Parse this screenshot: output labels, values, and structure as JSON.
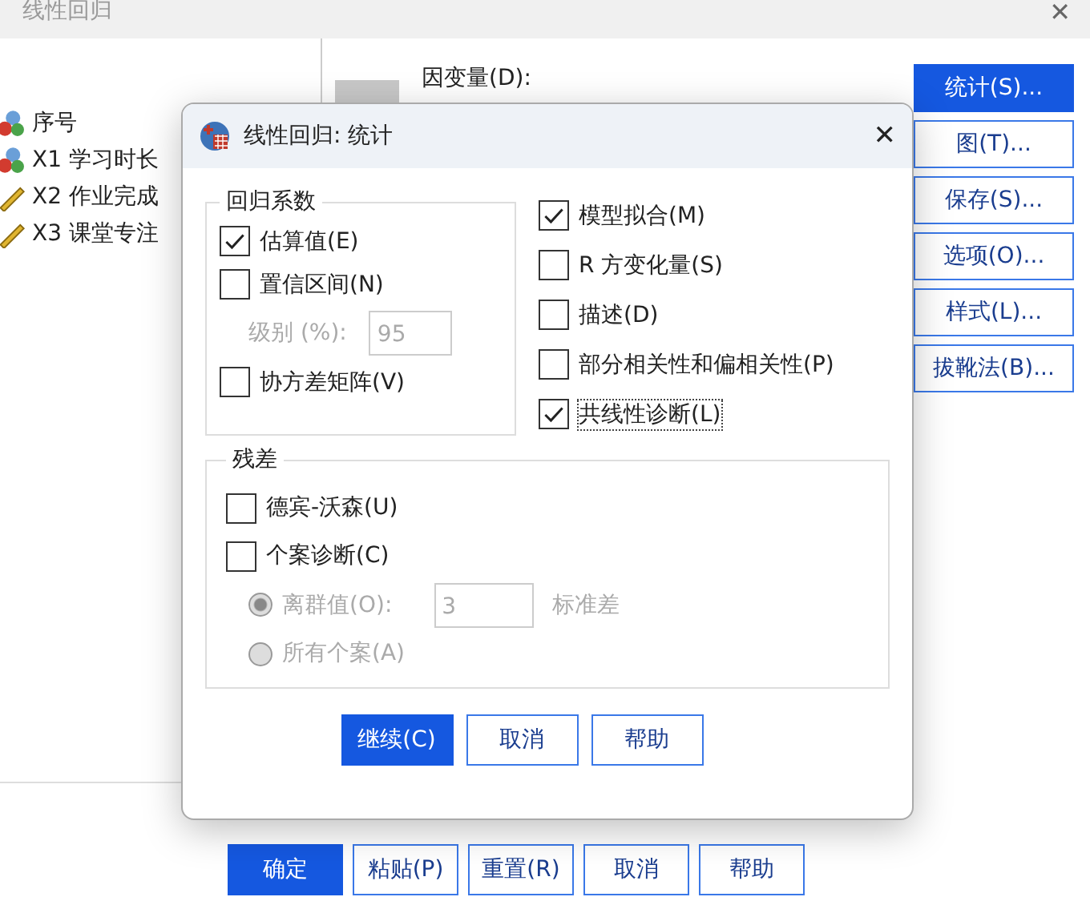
{
  "window": {
    "title": "线性回归",
    "close": "✕"
  },
  "variables": [
    {
      "kind": "scale",
      "label": "序号"
    },
    {
      "kind": "scale",
      "label": "X1 学习时长"
    },
    {
      "kind": "ordinal",
      "label": "X2 作业完成"
    },
    {
      "kind": "ordinal",
      "label": "X3 课堂专注"
    }
  ],
  "dependent_label": "因变量(D):",
  "side_buttons": [
    {
      "label": "统计(S)...",
      "selected": true
    },
    {
      "label": "图(T)...",
      "selected": false
    },
    {
      "label": "保存(S)...",
      "selected": false
    },
    {
      "label": "选项(O)...",
      "selected": false
    },
    {
      "label": "样式(L)...",
      "selected": false
    },
    {
      "label": "拔靴法(B)...",
      "selected": false
    }
  ],
  "bottom_buttons": [
    {
      "label": "确定",
      "selected": true
    },
    {
      "label": "粘贴(P)",
      "selected": false
    },
    {
      "label": "重置(R)",
      "selected": false
    },
    {
      "label": "取消",
      "selected": false
    },
    {
      "label": "帮助",
      "selected": false
    }
  ],
  "dialog": {
    "title": "线性回归: 统计",
    "close": "✕",
    "coefficients": {
      "title": "回归系数",
      "items": [
        {
          "kind": "checkbox",
          "label": "估算值(E)",
          "checked": true
        },
        {
          "kind": "checkbox",
          "label": "置信区间(N)",
          "checked": false
        },
        {
          "kind": "field",
          "label": "级别 (%):",
          "value": "95",
          "disabled": true
        },
        {
          "kind": "checkbox",
          "label": "协方差矩阵(V)",
          "checked": false
        }
      ]
    },
    "options": [
      {
        "label": "模型拟合(M)",
        "checked": true,
        "focused": false
      },
      {
        "label": "R 方变化量(S)",
        "checked": false,
        "focused": false
      },
      {
        "label": "描述(D)",
        "checked": false,
        "focused": false
      },
      {
        "label": "部分相关性和偏相关性(P)",
        "checked": false,
        "focused": false
      },
      {
        "label": "共线性诊断(L)",
        "checked": true,
        "focused": true
      }
    ],
    "residuals": {
      "title": "残差",
      "items": [
        {
          "kind": "checkbox",
          "label": "德宾-沃森(U)",
          "checked": false
        },
        {
          "kind": "checkbox",
          "label": "个案诊断(C)",
          "checked": false
        },
        {
          "kind": "radio",
          "label": "离群值(O):",
          "selected": true,
          "disabled": true,
          "value": "3",
          "unit": "标准差"
        },
        {
          "kind": "radio",
          "label": "所有个案(A)",
          "selected": false,
          "disabled": true
        }
      ]
    },
    "buttons": [
      {
        "label": "继续(C)",
        "selected": true
      },
      {
        "label": "取消",
        "selected": false
      },
      {
        "label": "帮助",
        "selected": false
      }
    ]
  }
}
